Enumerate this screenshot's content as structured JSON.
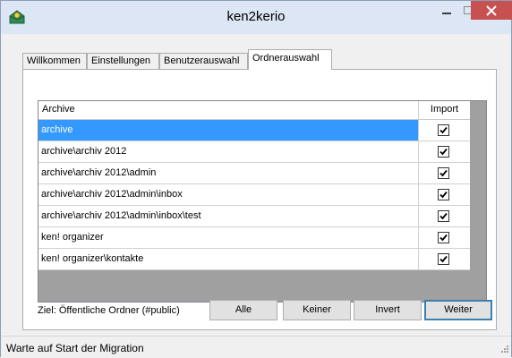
{
  "window": {
    "title": "ken2kerio"
  },
  "tabs": [
    {
      "label": "Willkommen",
      "active": false
    },
    {
      "label": "Einstellungen",
      "active": false
    },
    {
      "label": "Benutzerauswahl",
      "active": false
    },
    {
      "label": "Ordnerauswahl",
      "active": true
    }
  ],
  "grid": {
    "columns": {
      "name": "Archive",
      "import": "Import"
    },
    "rows": [
      {
        "name": "archive",
        "import": true,
        "selected": true
      },
      {
        "name": "archive\\archiv 2012",
        "import": true,
        "selected": false
      },
      {
        "name": "archive\\archiv 2012\\admin",
        "import": true,
        "selected": false
      },
      {
        "name": "archive\\archiv 2012\\admin\\inbox",
        "import": true,
        "selected": false
      },
      {
        "name": "archive\\archiv 2012\\admin\\inbox\\test",
        "import": true,
        "selected": false
      },
      {
        "name": "ken! organizer",
        "import": true,
        "selected": false
      },
      {
        "name": "ken! organizer\\kontakte",
        "import": true,
        "selected": false
      }
    ]
  },
  "footer": {
    "target_label": "Ziel: Öffentliche Ordner (#public)",
    "buttons": {
      "all": "Alle",
      "none": "Keiner",
      "invert": "Invert",
      "next": "Weiter"
    }
  },
  "status": {
    "text": "Warte auf Start der Migration"
  },
  "colors": {
    "selection": "#3399ff",
    "close": "#c75050",
    "titlebar": "#dce6f4"
  },
  "icons": [
    "app-icon",
    "minimize-icon",
    "maximize-icon",
    "close-icon",
    "checkmark-icon",
    "resize-grip-icon"
  ]
}
